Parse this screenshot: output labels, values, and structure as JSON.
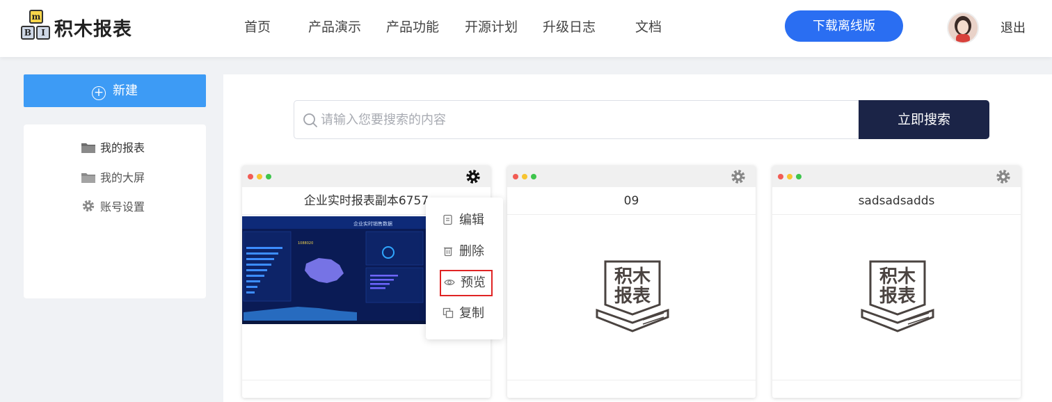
{
  "logo": {
    "blocks": [
      "m",
      "B",
      "I"
    ],
    "text": "积木报表"
  },
  "nav": [
    "首页",
    "产品演示",
    "产品功能",
    "开源计划",
    "升级日志",
    "文档"
  ],
  "header": {
    "download_label": "下载离线版",
    "logout_label": "退出"
  },
  "sidebar": {
    "new_label": "新建",
    "items": [
      {
        "label": "我的报表",
        "icon": "folder-icon"
      },
      {
        "label": "我的大屏",
        "icon": "folder-icon"
      },
      {
        "label": "账号设置",
        "icon": "gear-icon"
      }
    ]
  },
  "search": {
    "placeholder": "请输入您要搜索的内容",
    "button_label": "立即搜索"
  },
  "cards": [
    {
      "title": "企业实时报表副本6757",
      "thumbnail": "dashboard-preview",
      "thumb_title": "企业实时销售数据",
      "thumb_figure": "1088020"
    },
    {
      "title": "09",
      "thumbnail": "jimu-report-stamp"
    },
    {
      "title": "sadsadsadds",
      "thumbnail": "jimu-report-stamp"
    }
  ],
  "stamp": {
    "line1": "积木",
    "line2": "报表"
  },
  "card_menu": {
    "items": [
      "编辑",
      "删除",
      "预览",
      "复制"
    ],
    "highlighted": "预览"
  },
  "colors": {
    "primary": "#2a6ef2",
    "new_button": "#3d9bf5",
    "search_button": "#1b2447",
    "highlight_outline": "#e02424",
    "dot_red": "#f25c54",
    "dot_yellow": "#f7c431",
    "dot_green": "#3ec54c"
  }
}
